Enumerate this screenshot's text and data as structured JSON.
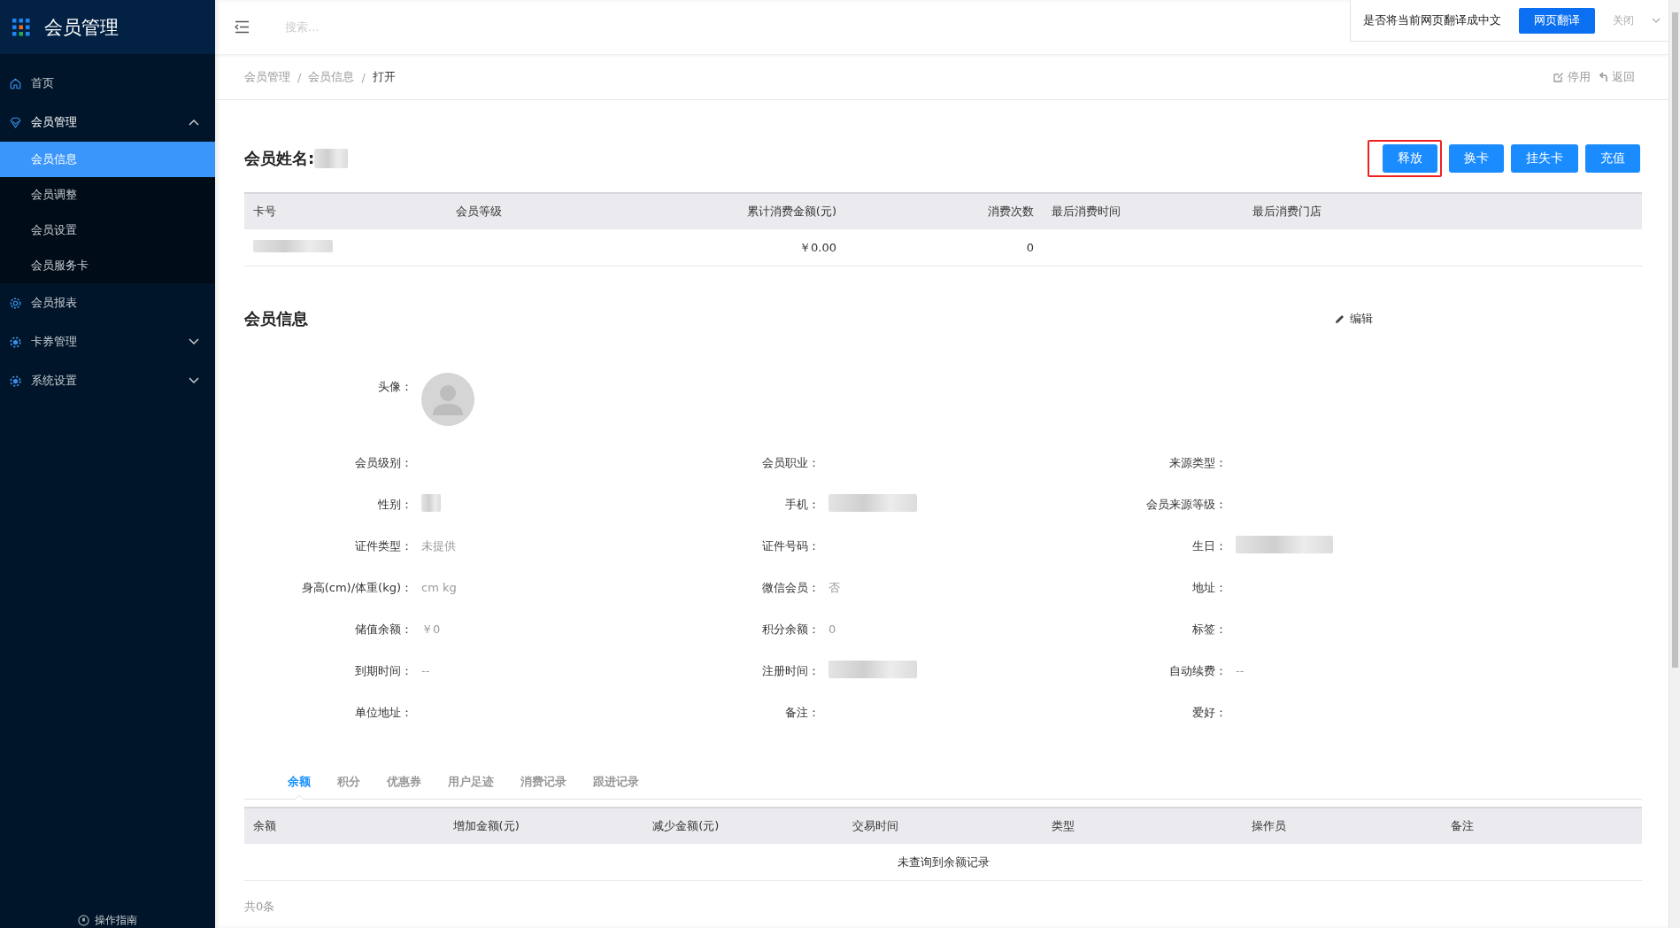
{
  "sidebar": {
    "title": "会员管理",
    "items": [
      {
        "label": "首页"
      },
      {
        "label": "会员管理",
        "expanded": true,
        "children": [
          {
            "label": "会员信息",
            "selected": true
          },
          {
            "label": "会员调整",
            "selected": false
          },
          {
            "label": "会员设置",
            "selected": false
          },
          {
            "label": "会员服务卡",
            "selected": false
          }
        ]
      },
      {
        "label": "会员报表"
      },
      {
        "label": "卡券管理",
        "expanded": false
      },
      {
        "label": "系统设置",
        "expanded": false
      }
    ],
    "footer": "操作指南"
  },
  "header": {
    "search_placeholder": "搜索..."
  },
  "translate_bar": {
    "prompt": "是否将当前网页翻译成中文",
    "button": "网页翻译",
    "close": "关闭"
  },
  "breadcrumb": {
    "items": [
      "会员管理",
      "会员信息",
      "打开"
    ],
    "separator": "/"
  },
  "page_actions": [
    "停用",
    "返回"
  ],
  "member": {
    "name_label": "会员姓名:",
    "name_redacted": true,
    "buttons": [
      {
        "label": "释放",
        "highlighted": true
      },
      {
        "label": "换卡",
        "highlighted": false
      },
      {
        "label": "挂失卡",
        "highlighted": false
      },
      {
        "label": "充值",
        "highlighted": false
      }
    ]
  },
  "card_table": {
    "columns": [
      "卡号",
      "会员等级",
      "累计消费金额(元)",
      "消费次数",
      "最后消费时间",
      "最后消费门店"
    ],
    "rows": [
      {
        "cells": [
          {
            "redacted": true
          },
          {
            "redacted": false
          },
          {
            "text": "￥0.00",
            "redacted": false
          },
          {
            "text": "0",
            "redacted": false
          },
          {
            "redacted": false
          },
          {
            "redacted": false
          }
        ]
      }
    ]
  },
  "member_info": {
    "title": "会员信息",
    "edit": "编辑",
    "rows": [
      [
        {
          "label": "头像：",
          "kind": "avatar"
        }
      ],
      [
        {
          "label": "会员级别：",
          "kind": "text",
          "redacted": false
        },
        {
          "label": "会员职业：",
          "kind": "text",
          "redacted": false
        },
        {
          "label": "来源类型：",
          "kind": "text",
          "redacted": false
        }
      ],
      [
        {
          "label": "性别：",
          "kind": "text",
          "redacted": true
        },
        {
          "label": "手机：",
          "kind": "text",
          "redacted": true
        },
        {
          "label": "会员来源等级：",
          "kind": "text",
          "redacted": false
        }
      ],
      [
        {
          "label": "证件类型：",
          "value": "未提供",
          "kind": "text",
          "redacted": false
        },
        {
          "label": "证件号码：",
          "kind": "text",
          "redacted": false
        },
        {
          "label": "生日：",
          "kind": "text",
          "redacted": true
        }
      ],
      [
        {
          "label": "身高(cm)/体重(kg)：",
          "value": "cm kg",
          "kind": "text",
          "redacted": false
        },
        {
          "label": "微信会员：",
          "value": "否",
          "kind": "text",
          "redacted": false
        },
        {
          "label": "地址：",
          "kind": "text",
          "redacted": false
        }
      ],
      [
        {
          "label": "储值余额：",
          "value": "￥0",
          "kind": "text",
          "redacted": false
        },
        {
          "label": "积分余额：",
          "value": "0",
          "kind": "text",
          "redacted": false
        },
        {
          "label": "标签：",
          "kind": "text",
          "redacted": false
        }
      ],
      [
        {
          "label": "到期时间：",
          "value": "--",
          "kind": "text",
          "redacted": false
        },
        {
          "label": "注册时间：",
          "kind": "text",
          "redacted": true
        },
        {
          "label": "自动续费：",
          "value": "--",
          "kind": "text",
          "redacted": false
        }
      ],
      [
        {
          "label": "单位地址：",
          "kind": "text",
          "redacted": false
        },
        {
          "label": "备注：",
          "kind": "text",
          "redacted": false
        },
        {
          "label": "爱好：",
          "kind": "text",
          "redacted": false
        }
      ]
    ]
  },
  "record_tabs": [
    {
      "label": "余额",
      "selected": true
    },
    {
      "label": "积分",
      "selected": false
    },
    {
      "label": "优惠券",
      "selected": false
    },
    {
      "label": "用户足迹",
      "selected": false
    },
    {
      "label": "消费记录",
      "selected": false
    },
    {
      "label": "跟进记录",
      "selected": false
    }
  ],
  "record_table": {
    "columns": [
      "余额",
      "增加金额(元)",
      "减少金额(元)",
      "交易时间",
      "类型",
      "操作员",
      "备注"
    ],
    "empty_message": "未查询到余额记录"
  },
  "total": "共0条"
}
